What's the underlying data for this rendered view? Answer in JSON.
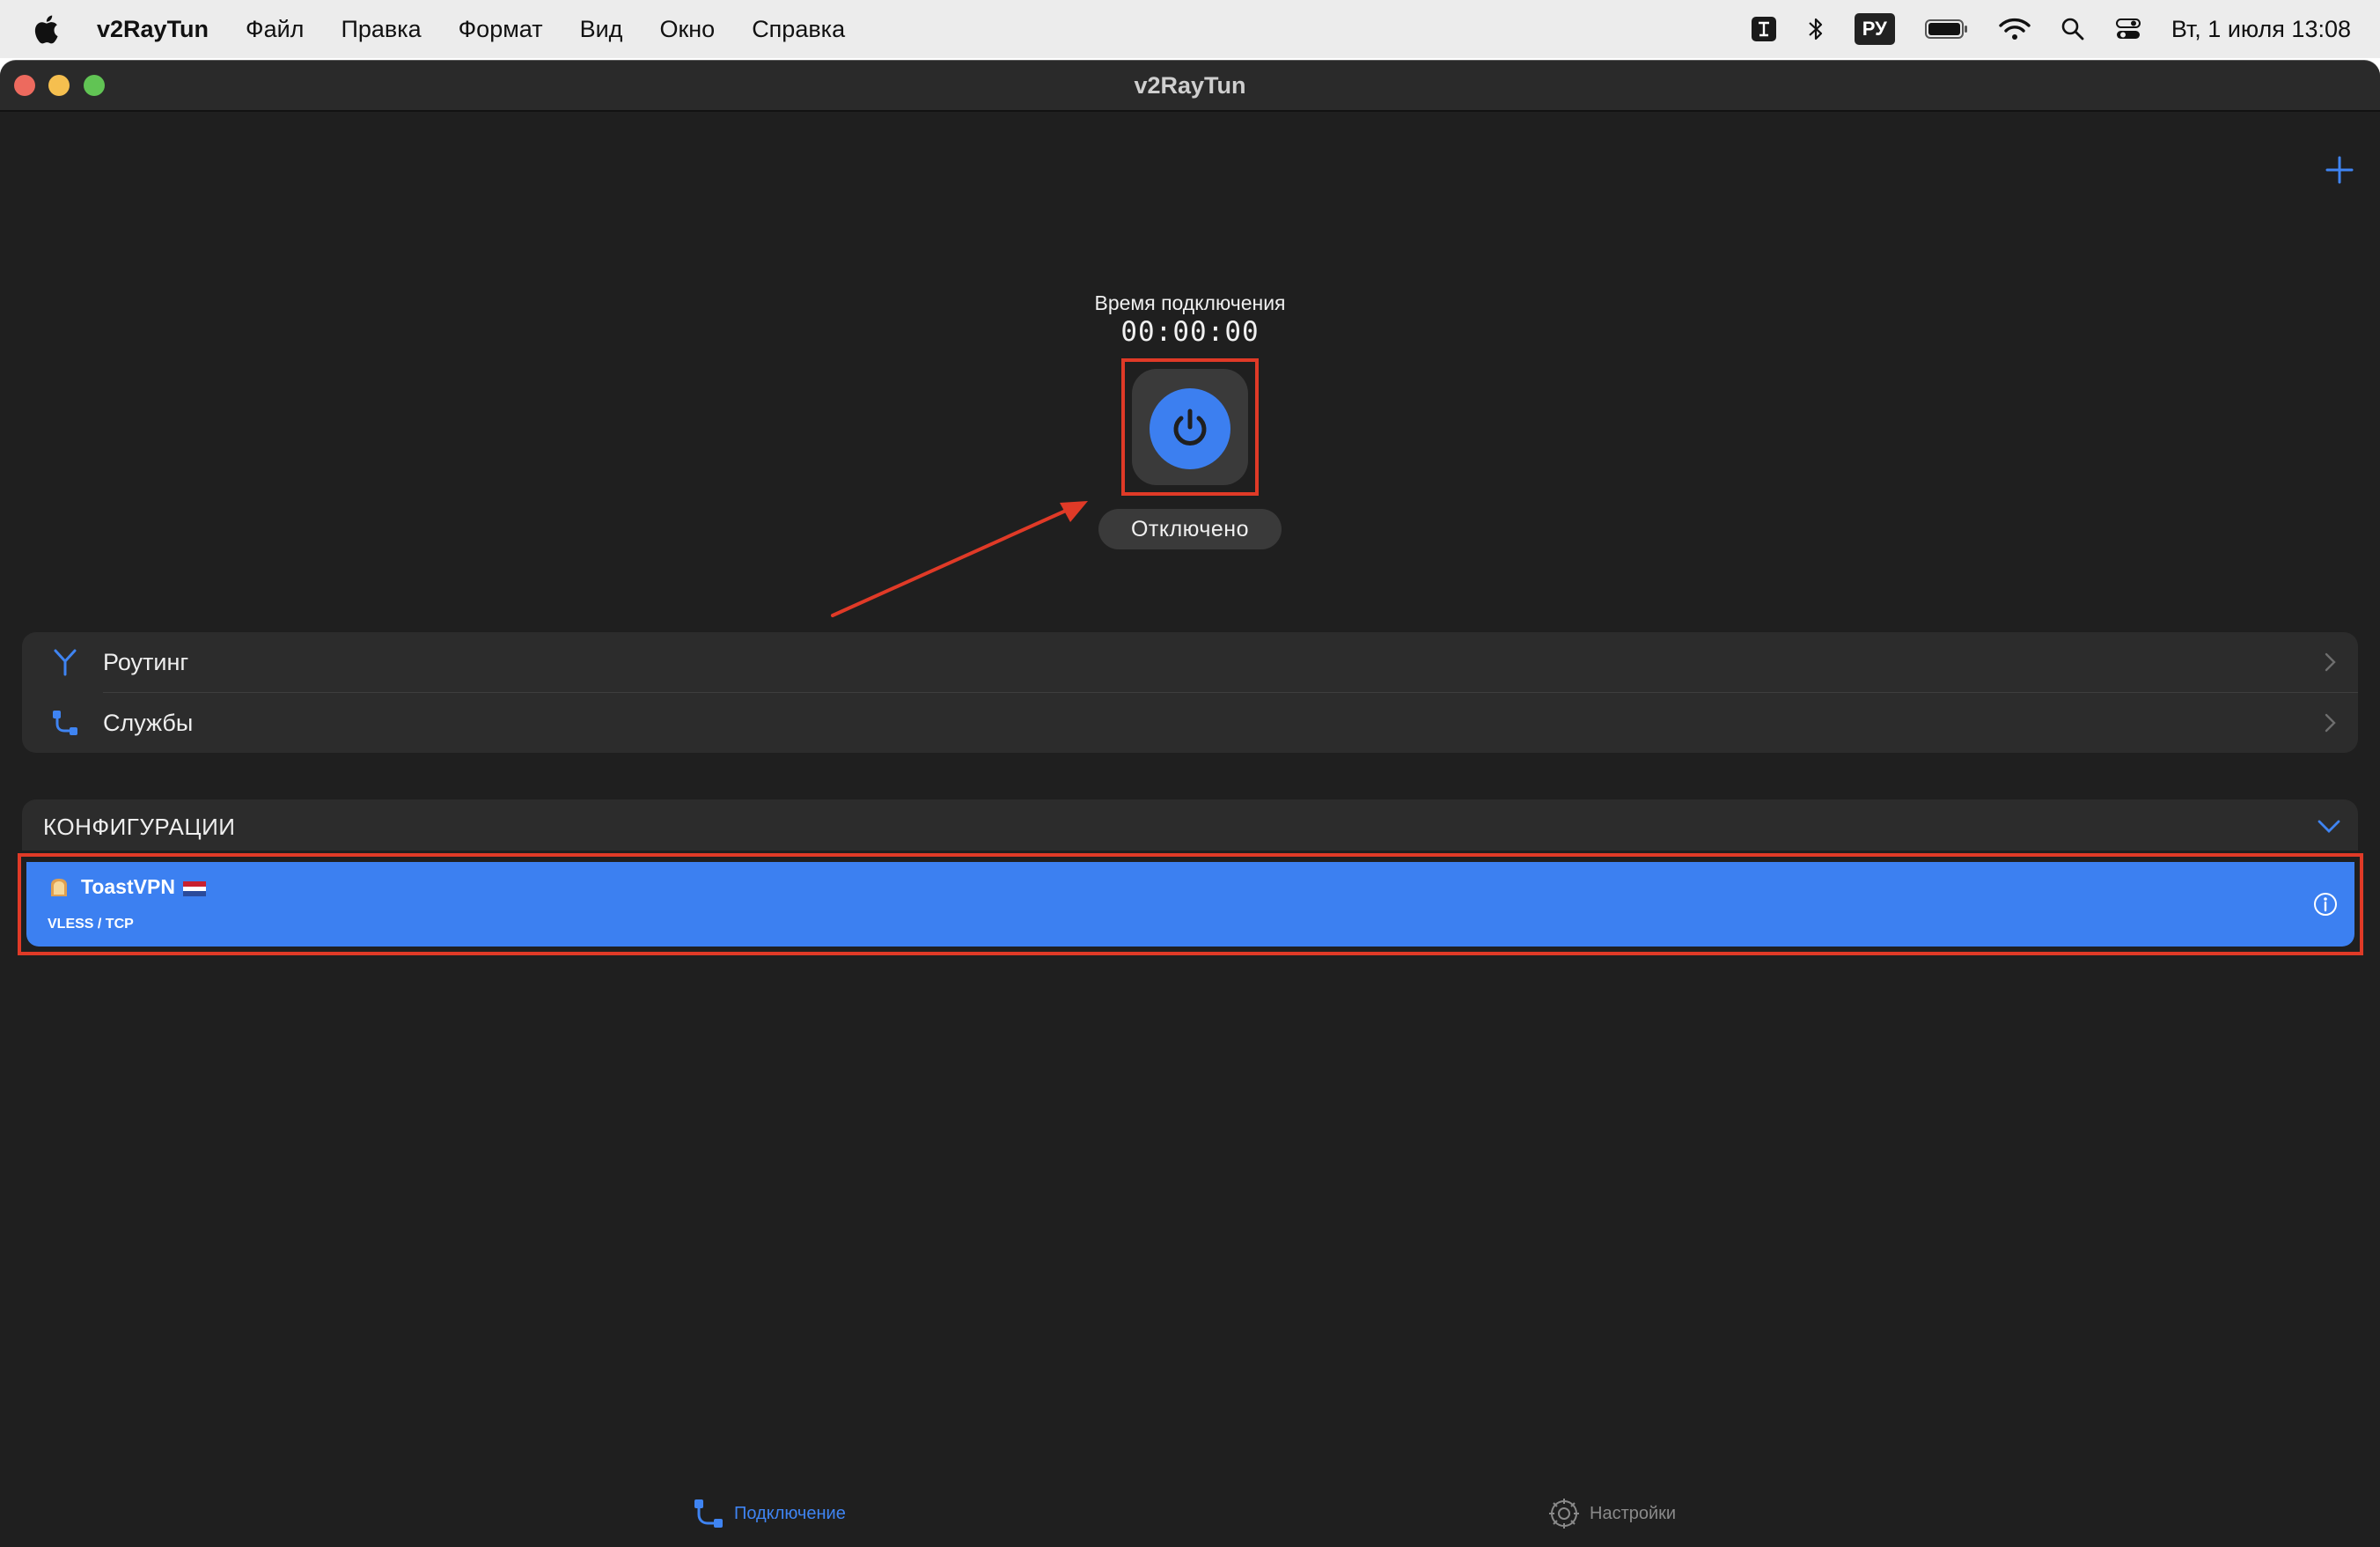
{
  "menubar": {
    "app_name": "v2RayTun",
    "items": [
      "Файл",
      "Правка",
      "Формат",
      "Вид",
      "Окно",
      "Справка"
    ],
    "status_icons": [
      "text-input-icon",
      "bluetooth-icon",
      "battery-icon",
      "wifi-icon",
      "search-icon",
      "control-center-icon"
    ],
    "language": "РУ",
    "clock": "Вт, 1 июля  13:08"
  },
  "window": {
    "title": "v2RayTun"
  },
  "connection": {
    "time_label": "Время подключения",
    "timer": "00:00:00",
    "status": "Отключено"
  },
  "list": {
    "items": [
      {
        "label": "Роутинг",
        "icon": "routing-icon"
      },
      {
        "label": "Службы",
        "icon": "services-icon"
      }
    ]
  },
  "configurations": {
    "header": "КОНФИГУРАЦИИ",
    "items": [
      {
        "name": "ToastVPN",
        "protocol": "VLESS / TCP",
        "emoji": "toast-emoji-icon",
        "flag": "netherlands-flag-icon"
      }
    ]
  },
  "tabs": {
    "connection": "Подключение",
    "settings": "Настройки"
  },
  "colors": {
    "accent": "#3c80f1",
    "window_bg": "#1f1f1f",
    "card_bg": "#2c2c2c",
    "annotation": "#e03a27"
  }
}
